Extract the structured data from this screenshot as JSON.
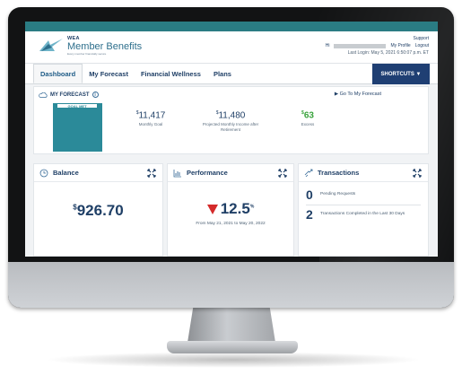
{
  "header": {
    "logo": {
      "wea": "WEA",
      "name": "Member Benefits",
      "tagline": "Every member financially secure"
    },
    "links": {
      "support": "Support",
      "greeting": "Hi",
      "my_profile": "My Profile",
      "logout": "Logout"
    },
    "last_login": "Last Login: May 5, 2021 6:50:07 p.m. ET"
  },
  "nav": {
    "tabs": [
      {
        "label": "Dashboard",
        "active": true
      },
      {
        "label": "My Forecast"
      },
      {
        "label": "Financial Wellness"
      },
      {
        "label": "Plans"
      }
    ],
    "shortcuts": "SHORTCUTS ▼"
  },
  "forecast": {
    "title": "MY FORECAST",
    "info": "i",
    "link": "▶ Go To My Forecast",
    "badge": "GOAL MET",
    "metrics": [
      {
        "value": "11,417",
        "currency": "$",
        "label": "Monthly Goal"
      },
      {
        "value": "11,480",
        "currency": "$",
        "label": "Projected Monthly Income after Retirement"
      },
      {
        "value": "63",
        "currency": "$",
        "label": "Excess"
      }
    ]
  },
  "balance": {
    "title": "Balance",
    "currency": "$",
    "value": "926.70"
  },
  "performance": {
    "title": "Performance",
    "value": "12.5",
    "unit": "%",
    "range": "From May 21, 2021 to May 20, 2022"
  },
  "transactions": {
    "title": "Transactions",
    "items": [
      {
        "count": "0",
        "label": "Pending Requests"
      },
      {
        "count": "2",
        "label": "Transactions Completed in the Last 30 Days"
      }
    ]
  },
  "colors": {
    "teal": "#2a7c83",
    "navy": "#1f3f73",
    "goal_card": "#2b8a99",
    "excess_green": "#3aa33d",
    "down_red": "#d42a2a"
  }
}
